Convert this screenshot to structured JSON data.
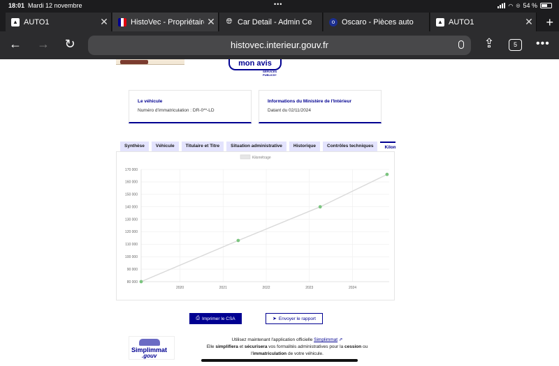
{
  "status": {
    "time": "18:01",
    "date": "Mardi 12 novembre",
    "battery": "54 %"
  },
  "tabs": [
    {
      "title": "AUTO1",
      "favicon": "auto1-icon",
      "active": false
    },
    {
      "title": "HistoVec - Propriétaire",
      "favicon": "french-flag-icon",
      "active": true
    },
    {
      "title": "Car Detail - Admin Ce",
      "favicon": "globe-icon",
      "active": false
    },
    {
      "title": "Oscaro - Pièces auto",
      "favicon": "oscaro-icon",
      "active": false
    },
    {
      "title": "AUTO1",
      "favicon": "auto1-icon",
      "active": false
    }
  ],
  "address": {
    "url": "histovec.interieur.gouv.fr",
    "tab_count": "5"
  },
  "header": {
    "avis_text": "mon avis",
    "services_publics": "SERVICES PUBLICS+"
  },
  "vehicle_card": {
    "title": "Le véhicule",
    "text": "Numéro d'immatriculation : DR-0**-LD"
  },
  "ministry_card": {
    "title": "Informations du Ministère de l'Intérieur",
    "text": "Datant du 02/11/2024"
  },
  "section_tabs": [
    {
      "label": "Synthèse"
    },
    {
      "label": "Véhicule"
    },
    {
      "label": "Titulaire et Titre"
    },
    {
      "label": "Situation administrative"
    },
    {
      "label": "Historique"
    },
    {
      "label": "Contrôles techniques"
    },
    {
      "label": "Kilométrage"
    }
  ],
  "chart_data": {
    "type": "line",
    "legend": [
      "Kilométrage"
    ],
    "series": [
      {
        "name": "Kilométrage",
        "points": [
          {
            "x": 2019.1,
            "y": 80000
          },
          {
            "x": 2021.35,
            "y": 113000
          },
          {
            "x": 2023.25,
            "y": 140000
          },
          {
            "x": 2024.8,
            "y": 166000
          }
        ]
      }
    ],
    "y_ticks": [
      80000,
      90000,
      100000,
      110000,
      120000,
      130000,
      140000,
      150000,
      160000,
      170000
    ],
    "y_tick_labels": [
      "80 000",
      "90 000",
      "100 000",
      "110 000",
      "120 000",
      "130 000",
      "140 000",
      "150 000",
      "160 000",
      "170 000"
    ],
    "x_ticks": [
      2020,
      2021,
      2022,
      2023,
      2024
    ],
    "xlim": [
      2019.1,
      2024.85
    ],
    "ylim": [
      80000,
      170000
    ],
    "grid": true,
    "colors": {
      "line": "#d9d9d9",
      "point": "#7bc47f"
    }
  },
  "actions": {
    "print_label": "Imprimer le CSA",
    "send_label": "Envoyer le rapport"
  },
  "promo": {
    "logo_name": "Simplimmat",
    "logo_suffix": ".gouv",
    "line1_prefix": "Utilisez maintenant l'application officielle",
    "line1_link": "Simplimmat",
    "line2_a": "Elle",
    "line2_b": "simplifiera",
    "line2_c": "et",
    "line2_d": "sécurisera",
    "line2_e": "vos formalités administratives pour la",
    "line2_f": "cession",
    "line2_g": "ou",
    "line3_a": "l'",
    "line3_b": "immatriculation",
    "line3_c": "de votre véhicule."
  }
}
